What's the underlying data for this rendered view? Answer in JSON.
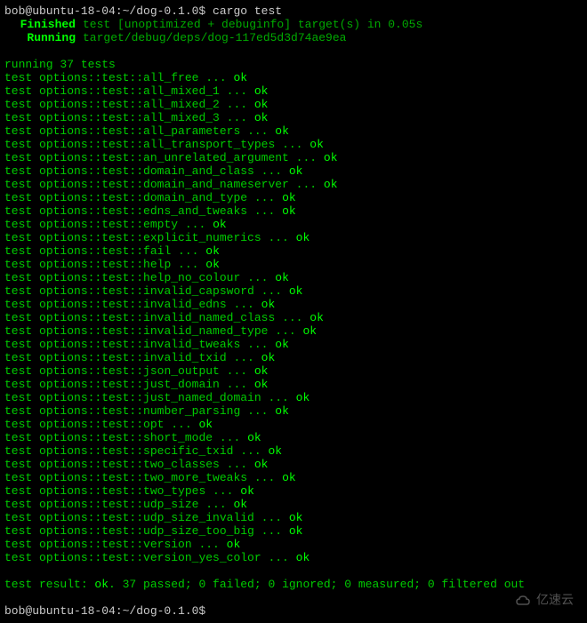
{
  "prompt1": "bob@ubuntu-18-04:~/dog-0.1.0$ ",
  "command": "cargo test",
  "finished_label": "Finished",
  "finished_text": "test [unoptimized + debuginfo] target(s) in 0.05s",
  "running_label": "Running",
  "running_text": "target/debug/deps/dog-117ed5d3d74ae9ea",
  "running_header": "running 37 tests",
  "tests": [
    "options::test::all_free",
    "options::test::all_mixed_1",
    "options::test::all_mixed_2",
    "options::test::all_mixed_3",
    "options::test::all_parameters",
    "options::test::all_transport_types",
    "options::test::an_unrelated_argument",
    "options::test::domain_and_class",
    "options::test::domain_and_nameserver",
    "options::test::domain_and_type",
    "options::test::edns_and_tweaks",
    "options::test::empty",
    "options::test::explicit_numerics",
    "options::test::fail",
    "options::test::help",
    "options::test::help_no_colour",
    "options::test::invalid_capsword",
    "options::test::invalid_edns",
    "options::test::invalid_named_class",
    "options::test::invalid_named_type",
    "options::test::invalid_tweaks",
    "options::test::invalid_txid",
    "options::test::json_output",
    "options::test::just_domain",
    "options::test::just_named_domain",
    "options::test::number_parsing",
    "options::test::opt",
    "options::test::short_mode",
    "options::test::specific_txid",
    "options::test::two_classes",
    "options::test::two_more_tweaks",
    "options::test::two_types",
    "options::test::udp_size",
    "options::test::udp_size_invalid",
    "options::test::udp_size_too_big",
    "options::test::version",
    "options::test::version_yes_color"
  ],
  "test_prefix": "test ",
  "test_dots": " ... ",
  "test_ok": "ok",
  "result_prefix": "test result: ",
  "result_ok": "ok",
  "result_suffix": ". 37 passed; 0 failed; 0 ignored; 0 measured; 0 filtered out",
  "prompt2": "bob@ubuntu-18-04:~/dog-0.1.0$",
  "watermark": "亿速云"
}
